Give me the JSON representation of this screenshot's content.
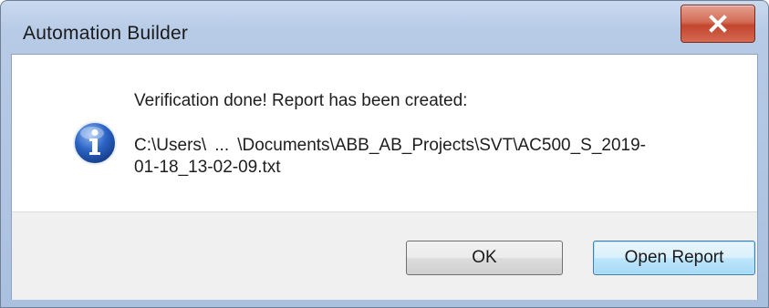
{
  "window": {
    "title": "Automation Builder",
    "close_label": "X"
  },
  "message": {
    "headline": "Verification done!  Report has been created:",
    "path_part1": "C:\\Users\\",
    "path_ellipsis": "...",
    "path_part2": "\\Documents\\ABB_AB_Projects\\SVT\\AC500_S_2019-",
    "path_line2": "01-18_13-02-09.txt"
  },
  "buttons": {
    "ok_label": "OK",
    "open_report_label": "Open Report"
  },
  "icons": {
    "message_icon": "info-icon",
    "close_icon": "close-icon"
  },
  "colors": {
    "title_bar": "#b7cbe6",
    "close_button": "#c3452d",
    "info_icon": "#2b63c4",
    "footer": "#f0f0f0",
    "default_button_border": "#3c7fb1"
  }
}
